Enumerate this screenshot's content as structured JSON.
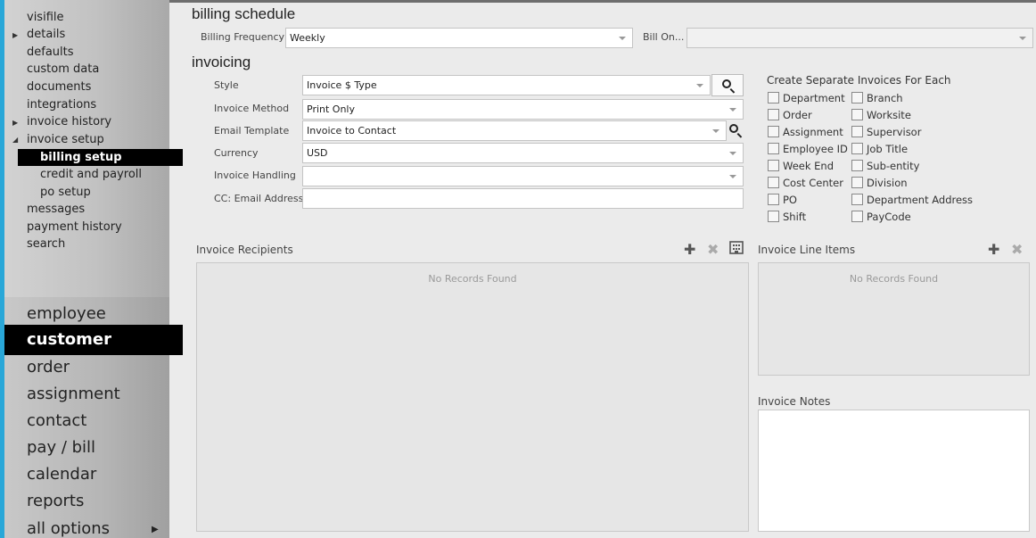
{
  "subnav": {
    "items": [
      {
        "label": "visifile"
      },
      {
        "label": "details"
      },
      {
        "label": "defaults"
      },
      {
        "label": "custom data"
      },
      {
        "label": "documents"
      },
      {
        "label": "integrations"
      },
      {
        "label": "invoice history"
      },
      {
        "label": "invoice setup"
      },
      {
        "label": "billing setup"
      },
      {
        "label": "credit and payroll"
      },
      {
        "label": "po setup"
      },
      {
        "label": "messages"
      },
      {
        "label": "payment history"
      },
      {
        "label": "search"
      }
    ]
  },
  "mainnav": {
    "items": [
      {
        "label": "employee"
      },
      {
        "label": "customer"
      },
      {
        "label": "order"
      },
      {
        "label": "assignment"
      },
      {
        "label": "contact"
      },
      {
        "label": "pay / bill"
      },
      {
        "label": "calendar"
      },
      {
        "label": "reports"
      },
      {
        "label": "all options"
      }
    ]
  },
  "billing_schedule": {
    "heading": "billing schedule",
    "frequency_label": "Billing Frequency",
    "frequency_value": "Weekly",
    "bill_on_label": "Bill On...",
    "bill_on_value": ""
  },
  "invoicing": {
    "heading": "invoicing",
    "style_label": "Style",
    "style_value": "Invoice $ Type",
    "method_label": "Invoice Method",
    "method_value": "Print Only",
    "email_template_label": "Email Template",
    "email_template_value": "Invoice to Contact",
    "currency_label": "Currency",
    "currency_value": "USD",
    "handling_label": "Invoice Handling",
    "handling_value": "",
    "cc_label": "CC: Email Address",
    "cc_value": ""
  },
  "separate_invoices": {
    "heading": "Create Separate Invoices For Each",
    "left": [
      "Department",
      "Order",
      "Assignment",
      "Employee ID",
      "Week End",
      "Cost Center",
      "PO",
      "Shift"
    ],
    "right": [
      "Branch",
      "Worksite",
      "Supervisor",
      "Job Title",
      "Sub-entity",
      "Division",
      "Department Address",
      "PayCode"
    ]
  },
  "recipients": {
    "title": "Invoice Recipients",
    "empty": "No Records Found"
  },
  "line_items": {
    "title": "Invoice Line Items",
    "empty": "No Records Found"
  },
  "notes": {
    "title": "Invoice Notes"
  },
  "colors": {
    "accent": "#29a7d8",
    "active_bg": "#000000"
  }
}
